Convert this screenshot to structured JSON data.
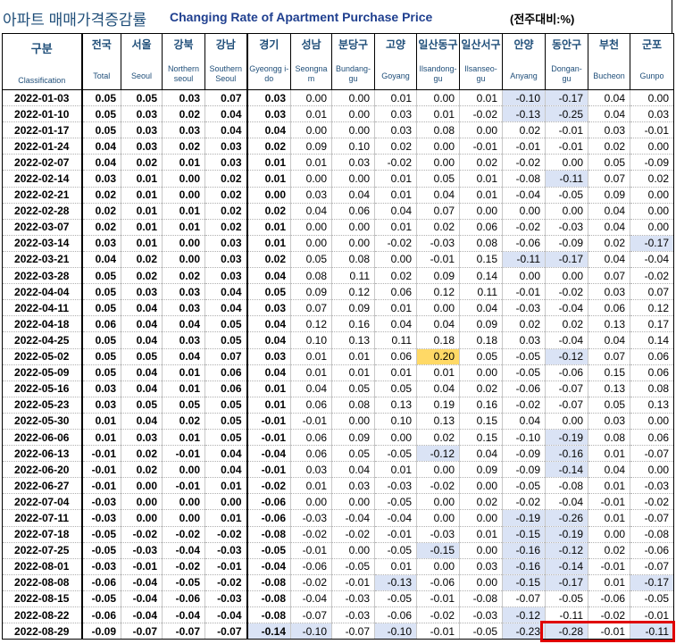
{
  "title": {
    "korean": "아파트 매매가격증감률",
    "english": "Changing Rate of Apartment Purchase Price",
    "unit": "(전주대비:%)"
  },
  "columns": [
    {
      "key": "class",
      "kr": "구분",
      "en": "Classification"
    },
    {
      "key": "total",
      "kr": "전국",
      "en": "Total"
    },
    {
      "key": "seoul",
      "kr": "서울",
      "en": "Seoul"
    },
    {
      "key": "north",
      "kr": "강북",
      "en": "Northern seoul"
    },
    {
      "key": "south",
      "kr": "강남",
      "en": "Southern Seoul"
    },
    {
      "key": "gyeonggi",
      "kr": "경기",
      "en": "Gyeongg i-do"
    },
    {
      "key": "seongnam",
      "kr": "성남",
      "en": "Seongna m"
    },
    {
      "key": "bundang",
      "kr": "분당구",
      "en": "Bundang- gu"
    },
    {
      "key": "goyang",
      "kr": "고양",
      "en": "Goyang"
    },
    {
      "key": "ilsandong",
      "kr": "일산동구",
      "en": "Ilsandong- gu"
    },
    {
      "key": "ilsanseo",
      "kr": "일산서구",
      "en": "Ilsanseo- gu"
    },
    {
      "key": "anyang",
      "kr": "안양",
      "en": "Anyang"
    },
    {
      "key": "dongan",
      "kr": "동안구",
      "en": "Dongan- gu"
    },
    {
      "key": "bucheon",
      "kr": "부천",
      "en": "Bucheon"
    },
    {
      "key": "gunpo",
      "kr": "군포",
      "en": "Gunpo"
    }
  ],
  "highlight_colors": {
    "blue": "#dae3f5",
    "yellow": "#ffd966",
    "box": "#e00000"
  },
  "rows": [
    {
      "date": "2022-01-03",
      "v": [
        "0.05",
        "0.05",
        "0.03",
        "0.07",
        "0.03",
        "0.00",
        "0.00",
        "0.01",
        "0.00",
        "0.01",
        "-0.10",
        "-0.17",
        "0.04",
        "0.00"
      ],
      "hl": {
        "10": "blue",
        "11": "blue"
      }
    },
    {
      "date": "2022-01-10",
      "v": [
        "0.05",
        "0.03",
        "0.02",
        "0.04",
        "0.03",
        "0.01",
        "0.00",
        "0.03",
        "0.01",
        "-0.02",
        "-0.13",
        "-0.25",
        "0.04",
        "0.03"
      ],
      "hl": {
        "10": "blue",
        "11": "blue"
      }
    },
    {
      "date": "2022-01-17",
      "v": [
        "0.05",
        "0.03",
        "0.03",
        "0.04",
        "0.04",
        "0.00",
        "0.00",
        "0.03",
        "0.08",
        "0.00",
        "0.02",
        "-0.01",
        "0.03",
        "-0.01"
      ],
      "hl": {}
    },
    {
      "date": "2022-01-24",
      "v": [
        "0.04",
        "0.03",
        "0.02",
        "0.03",
        "0.02",
        "0.09",
        "0.10",
        "0.02",
        "0.00",
        "-0.01",
        "-0.01",
        "-0.01",
        "0.02",
        "0.00"
      ],
      "hl": {}
    },
    {
      "date": "2022-02-07",
      "v": [
        "0.04",
        "0.02",
        "0.01",
        "0.03",
        "0.01",
        "0.01",
        "0.03",
        "-0.02",
        "0.00",
        "0.02",
        "-0.02",
        "0.00",
        "0.05",
        "-0.09"
      ],
      "hl": {}
    },
    {
      "date": "2022-02-14",
      "v": [
        "0.03",
        "0.01",
        "0.00",
        "0.02",
        "0.01",
        "0.00",
        "0.00",
        "0.01",
        "0.05",
        "0.01",
        "-0.08",
        "-0.11",
        "0.07",
        "0.02"
      ],
      "hl": {
        "11": "blue"
      }
    },
    {
      "date": "2022-02-21",
      "v": [
        "0.02",
        "0.01",
        "0.00",
        "0.02",
        "0.00",
        "0.03",
        "0.04",
        "0.01",
        "0.04",
        "0.01",
        "-0.04",
        "-0.05",
        "0.09",
        "0.00"
      ],
      "hl": {}
    },
    {
      "date": "2022-02-28",
      "v": [
        "0.02",
        "0.01",
        "0.01",
        "0.02",
        "0.02",
        "0.04",
        "0.06",
        "0.04",
        "0.07",
        "0.00",
        "0.00",
        "0.00",
        "0.04",
        "0.00"
      ],
      "hl": {}
    },
    {
      "date": "2022-03-07",
      "v": [
        "0.02",
        "0.01",
        "0.01",
        "0.02",
        "0.01",
        "0.00",
        "0.00",
        "0.01",
        "0.02",
        "0.06",
        "-0.02",
        "-0.03",
        "0.04",
        "0.00"
      ],
      "hl": {}
    },
    {
      "date": "2022-03-14",
      "v": [
        "0.03",
        "0.01",
        "0.00",
        "0.03",
        "0.01",
        "0.00",
        "0.00",
        "-0.02",
        "-0.03",
        "0.08",
        "-0.06",
        "-0.09",
        "0.02",
        "-0.17"
      ],
      "hl": {
        "13": "blue"
      }
    },
    {
      "date": "2022-03-21",
      "v": [
        "0.04",
        "0.02",
        "0.00",
        "0.03",
        "0.02",
        "0.05",
        "0.08",
        "0.00",
        "-0.01",
        "0.15",
        "-0.11",
        "-0.17",
        "0.04",
        "-0.04"
      ],
      "hl": {
        "10": "blue",
        "11": "blue"
      }
    },
    {
      "date": "2022-03-28",
      "v": [
        "0.05",
        "0.02",
        "0.02",
        "0.03",
        "0.04",
        "0.08",
        "0.11",
        "0.02",
        "0.09",
        "0.14",
        "0.00",
        "0.00",
        "0.07",
        "-0.02"
      ],
      "hl": {}
    },
    {
      "date": "2022-04-04",
      "v": [
        "0.05",
        "0.03",
        "0.03",
        "0.04",
        "0.05",
        "0.09",
        "0.12",
        "0.06",
        "0.12",
        "0.11",
        "-0.01",
        "-0.02",
        "0.03",
        "0.07"
      ],
      "hl": {}
    },
    {
      "date": "2022-04-11",
      "v": [
        "0.05",
        "0.04",
        "0.03",
        "0.04",
        "0.03",
        "0.07",
        "0.09",
        "0.01",
        "0.00",
        "0.04",
        "-0.03",
        "-0.04",
        "0.06",
        "0.12"
      ],
      "hl": {}
    },
    {
      "date": "2022-04-18",
      "v": [
        "0.06",
        "0.04",
        "0.04",
        "0.05",
        "0.04",
        "0.12",
        "0.16",
        "0.04",
        "0.04",
        "0.09",
        "0.02",
        "0.02",
        "0.13",
        "0.17"
      ],
      "hl": {}
    },
    {
      "date": "2022-04-25",
      "v": [
        "0.05",
        "0.04",
        "0.03",
        "0.05",
        "0.04",
        "0.10",
        "0.13",
        "0.11",
        "0.18",
        "0.18",
        "0.03",
        "-0.04",
        "0.04",
        "0.14"
      ],
      "hl": {}
    },
    {
      "date": "2022-05-02",
      "v": [
        "0.05",
        "0.05",
        "0.04",
        "0.07",
        "0.03",
        "0.01",
        "0.01",
        "0.06",
        "0.20",
        "0.05",
        "-0.05",
        "-0.12",
        "0.07",
        "0.06"
      ],
      "hl": {
        "8": "yellow",
        "11": "blue"
      }
    },
    {
      "date": "2022-05-09",
      "v": [
        "0.05",
        "0.04",
        "0.01",
        "0.06",
        "0.04",
        "0.01",
        "0.01",
        "0.01",
        "0.01",
        "0.00",
        "-0.05",
        "-0.06",
        "0.15",
        "0.06"
      ],
      "hl": {}
    },
    {
      "date": "2022-05-16",
      "v": [
        "0.03",
        "0.04",
        "0.01",
        "0.06",
        "0.01",
        "0.04",
        "0.05",
        "0.05",
        "0.04",
        "0.02",
        "-0.06",
        "-0.07",
        "0.13",
        "0.08"
      ],
      "hl": {}
    },
    {
      "date": "2022-05-23",
      "v": [
        "0.03",
        "0.05",
        "0.05",
        "0.05",
        "0.01",
        "0.06",
        "0.08",
        "0.13",
        "0.19",
        "0.16",
        "-0.02",
        "-0.07",
        "0.05",
        "0.13"
      ],
      "hl": {}
    },
    {
      "date": "2022-05-30",
      "v": [
        "0.01",
        "0.04",
        "0.02",
        "0.05",
        "-0.01",
        "-0.01",
        "0.00",
        "0.10",
        "0.13",
        "0.15",
        "0.04",
        "0.00",
        "0.03",
        "0.00"
      ],
      "hl": {}
    },
    {
      "date": "2022-06-06",
      "v": [
        "0.01",
        "0.03",
        "0.01",
        "0.05",
        "-0.01",
        "0.06",
        "0.09",
        "0.00",
        "0.02",
        "0.15",
        "-0.10",
        "-0.19",
        "0.08",
        "0.06"
      ],
      "hl": {
        "11": "blue"
      }
    },
    {
      "date": "2022-06-13",
      "v": [
        "-0.01",
        "0.02",
        "-0.01",
        "0.04",
        "-0.04",
        "0.06",
        "0.05",
        "-0.05",
        "-0.12",
        "0.04",
        "-0.09",
        "-0.16",
        "0.01",
        "-0.07"
      ],
      "hl": {
        "8": "blue",
        "11": "blue"
      }
    },
    {
      "date": "2022-06-20",
      "v": [
        "-0.01",
        "0.02",
        "0.00",
        "0.04",
        "-0.01",
        "0.03",
        "0.04",
        "0.01",
        "0.00",
        "0.09",
        "-0.09",
        "-0.14",
        "0.04",
        "0.00"
      ],
      "hl": {
        "11": "blue"
      }
    },
    {
      "date": "2022-06-27",
      "v": [
        "-0.01",
        "0.00",
        "-0.01",
        "0.01",
        "-0.02",
        "0.01",
        "0.03",
        "-0.03",
        "-0.02",
        "0.00",
        "-0.05",
        "-0.08",
        "0.01",
        "-0.03"
      ],
      "hl": {}
    },
    {
      "date": "2022-07-04",
      "v": [
        "-0.03",
        "0.00",
        "0.00",
        "0.00",
        "-0.06",
        "0.00",
        "0.00",
        "-0.05",
        "0.00",
        "0.02",
        "-0.02",
        "-0.04",
        "-0.01",
        "-0.02"
      ],
      "hl": {}
    },
    {
      "date": "2022-07-11",
      "v": [
        "-0.03",
        "0.00",
        "0.00",
        "0.01",
        "-0.06",
        "-0.03",
        "-0.04",
        "-0.04",
        "0.00",
        "0.00",
        "-0.19",
        "-0.26",
        "0.01",
        "-0.07"
      ],
      "hl": {
        "10": "blue",
        "11": "blue"
      }
    },
    {
      "date": "2022-07-18",
      "v": [
        "-0.05",
        "-0.02",
        "-0.02",
        "-0.02",
        "-0.08",
        "-0.02",
        "-0.02",
        "-0.01",
        "-0.03",
        "0.01",
        "-0.15",
        "-0.19",
        "0.00",
        "-0.08"
      ],
      "hl": {
        "10": "blue",
        "11": "blue"
      }
    },
    {
      "date": "2022-07-25",
      "v": [
        "-0.05",
        "-0.03",
        "-0.04",
        "-0.03",
        "-0.05",
        "-0.01",
        "0.00",
        "-0.05",
        "-0.15",
        "0.00",
        "-0.16",
        "-0.12",
        "0.02",
        "-0.06"
      ],
      "hl": {
        "8": "blue",
        "10": "blue",
        "11": "blue"
      }
    },
    {
      "date": "2022-08-01",
      "v": [
        "-0.03",
        "-0.01",
        "-0.02",
        "-0.01",
        "-0.04",
        "-0.06",
        "-0.05",
        "0.01",
        "0.00",
        "0.03",
        "-0.16",
        "-0.14",
        "-0.01",
        "-0.07"
      ],
      "hl": {
        "10": "blue",
        "11": "blue"
      }
    },
    {
      "date": "2022-08-08",
      "v": [
        "-0.06",
        "-0.04",
        "-0.05",
        "-0.02",
        "-0.08",
        "-0.02",
        "-0.01",
        "-0.13",
        "-0.06",
        "0.00",
        "-0.15",
        "-0.17",
        "0.01",
        "-0.17"
      ],
      "hl": {
        "7": "blue",
        "10": "blue",
        "11": "blue",
        "13": "blue"
      }
    },
    {
      "date": "2022-08-15",
      "v": [
        "-0.05",
        "-0.04",
        "-0.06",
        "-0.03",
        "-0.08",
        "-0.04",
        "-0.03",
        "-0.05",
        "-0.01",
        "-0.08",
        "-0.07",
        "-0.05",
        "-0.06",
        "-0.05"
      ],
      "hl": {}
    },
    {
      "date": "2022-08-22",
      "v": [
        "-0.06",
        "-0.04",
        "-0.04",
        "-0.04",
        "-0.08",
        "-0.07",
        "-0.03",
        "-0.06",
        "-0.02",
        "-0.03",
        "-0.12",
        "-0.11",
        "-0.02",
        "-0.01"
      ],
      "hl": {
        "10": "blue"
      }
    },
    {
      "date": "2022-08-29",
      "v": [
        "-0.09",
        "-0.07",
        "-0.07",
        "-0.07",
        "-0.14",
        "-0.10",
        "-0.07",
        "-0.10",
        "-0.01",
        "-0.05",
        "-0.23",
        "-0.28",
        "-0.01",
        "-0.11"
      ],
      "hl": {
        "4": "blue",
        "5": "blue",
        "7": "blue",
        "10": "blue",
        "11": "blue",
        "13": "blue"
      }
    }
  ]
}
